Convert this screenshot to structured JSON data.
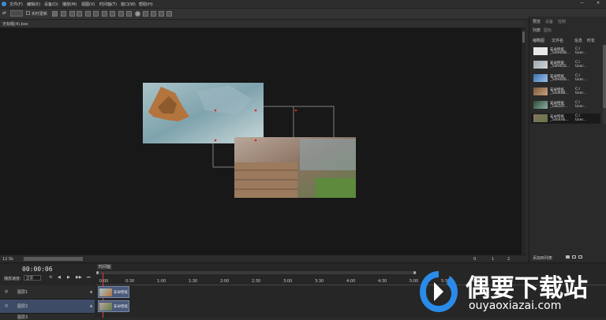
{
  "menu": [
    "文件(F)",
    "编辑(E)",
    "设备(D)",
    "播放(M)",
    "视图(V)",
    "时间轴(T)",
    "窗口(W)",
    "帮助(H)"
  ],
  "toolbar": {
    "realtime_label": "实时更新"
  },
  "tab": {
    "title": "无标题(4).bxx"
  },
  "status": {
    "zoom": "12.5k",
    "page_current": "0",
    "page_a": "1",
    "page_b": "2"
  },
  "panel": {
    "tabs": [
      "预览",
      "设备",
      "控制"
    ],
    "subtabs": [
      "列表",
      "图标"
    ],
    "columns": [
      "缩略图",
      "文件名",
      "信息",
      "时长"
    ],
    "items": [
      {
        "name": "安卓壁纸",
        "id": "_54fe608...",
        "info1": "C:/",
        "info2": "User..."
      },
      {
        "name": "安卓壁纸",
        "id": "_54fe616...",
        "info1": "C:/",
        "info2": "User..."
      },
      {
        "name": "安卓壁纸",
        "id": "_54fe606...",
        "info1": "C:/",
        "info2": "User..."
      },
      {
        "name": "安卓壁纸",
        "id": "_54d488...",
        "info1": "C:/",
        "info2": "User..."
      },
      {
        "name": "安卓壁纸",
        "id": "_54b32f...",
        "info1": "C:/",
        "info2": "User..."
      },
      {
        "name": "安卓壁纸",
        "id": "_54b4eb...",
        "info1": "C:/",
        "info2": "User..."
      }
    ],
    "footer_label": "添加到列表"
  },
  "timeline": {
    "time": "00:00:06",
    "speed_label": "播放速度:",
    "speed_value": "正常",
    "tab": "时间轴",
    "ruler": [
      "0:00",
      "0:30",
      "1:00",
      "1:30",
      "2:00",
      "2:30",
      "3:00",
      "3:30",
      "4:00",
      "4:30",
      "5:00",
      "5:30",
      "6:00",
      "6:30"
    ],
    "layers": [
      {
        "name": "图层1",
        "clip": "安卓壁纸"
      },
      {
        "name": "图层2",
        "clip": "安卓壁纸"
      },
      {
        "name": "图层3",
        "clip": ""
      }
    ]
  },
  "watermark": {
    "brand": "偶要下载站",
    "url": "ouyaoxiazai.com"
  },
  "colors": {
    "accent": "#2a8be8",
    "selection": "#3d4b66",
    "clip": "#4a5a7a"
  }
}
